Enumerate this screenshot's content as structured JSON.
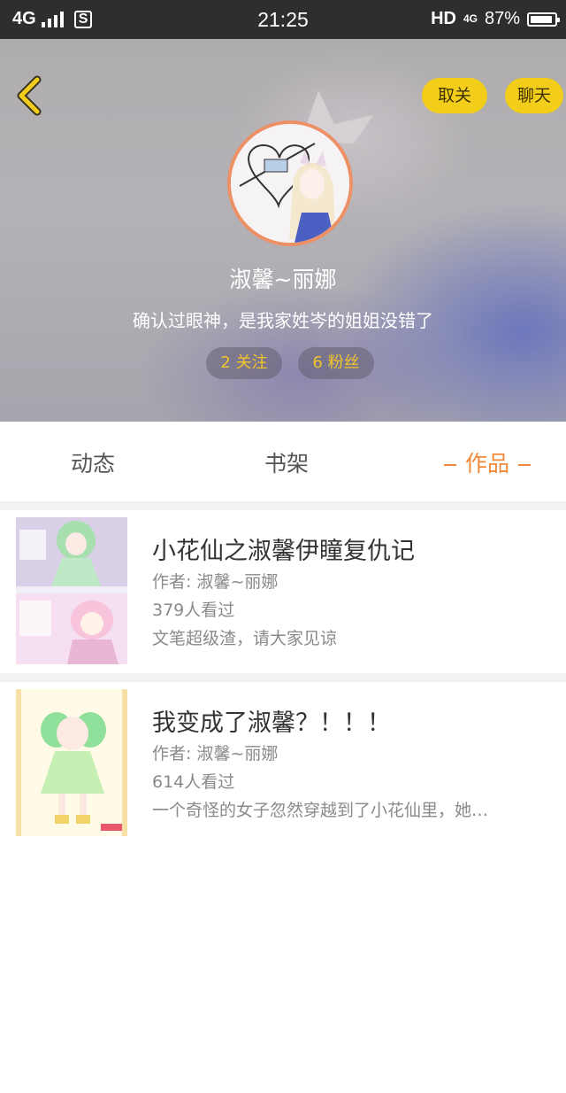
{
  "status_bar": {
    "network": "4G",
    "sim": "S",
    "time": "21:25",
    "hd": "HD",
    "net_right": "4G",
    "battery": "87%"
  },
  "header": {
    "unfollow_label": "取关",
    "chat_label": "聊天",
    "username": "淑馨~丽娜",
    "bio": "确认过眼神，是我家姓岑的姐姐没错了",
    "follow_count_label": "2 关注",
    "fans_count_label": "6 粉丝",
    "accent_color": "#f2cd1a"
  },
  "tabs": [
    {
      "label": "动态",
      "active": false
    },
    {
      "label": "书架",
      "active": false
    },
    {
      "label": "作品",
      "active": true
    }
  ],
  "works": [
    {
      "title": "小花仙之淑馨伊瞳复仇记",
      "author": "作者: 淑馨~丽娜",
      "views": "379人看过",
      "description": "文笔超级渣，请大家见谅"
    },
    {
      "title": "我变成了淑馨？！！！",
      "author": "作者: 淑馨~丽娜",
      "views": "614人看过",
      "description": "一个奇怪的女子忽然穿越到了小花仙里，她…"
    }
  ]
}
